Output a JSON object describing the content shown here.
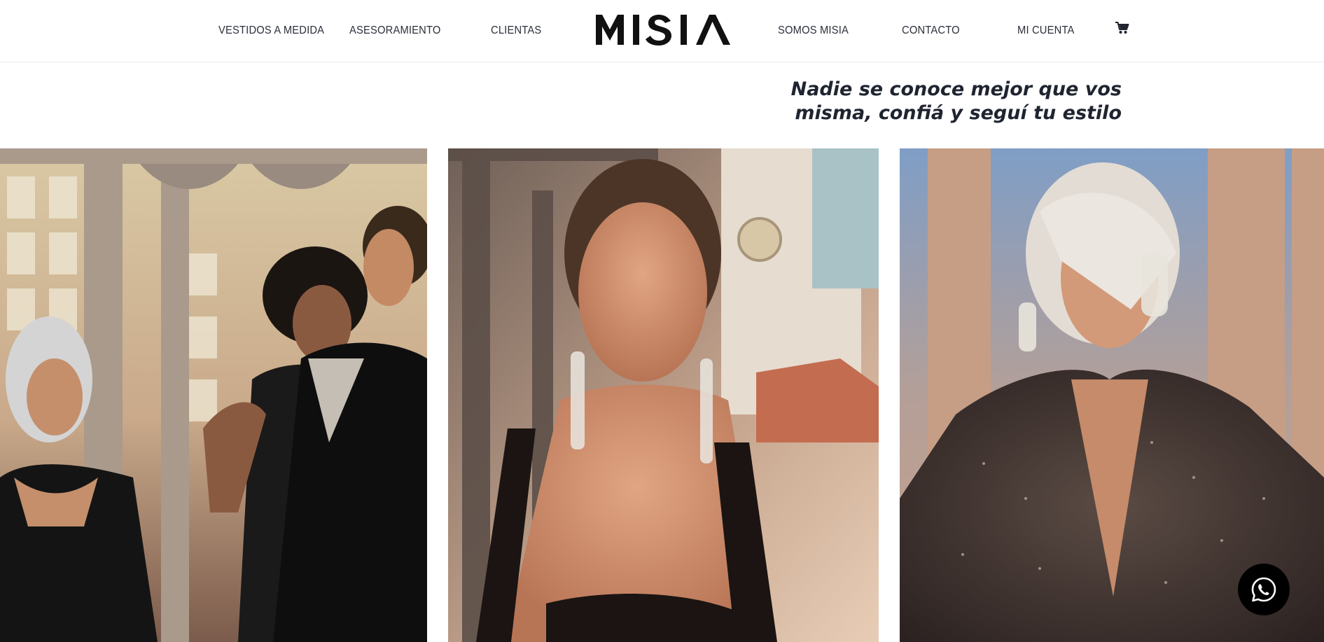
{
  "nav": {
    "left": [
      "VESTIDOS A MEDIDA",
      "ASESORAMIENTO",
      "CLIENTAS"
    ],
    "right": [
      "SOMOS MISIA",
      "CONTACTO",
      "MI CUENTA"
    ]
  },
  "brand": {
    "logo": "MISIA"
  },
  "hero": {
    "tagline_line1": "Nadie se conoce mejor que vos",
    "tagline_line2": "misma, confiá y seguí tu estilo"
  },
  "icons": {
    "cart": "cart-icon",
    "whatsapp": "whatsapp-icon"
  },
  "colors": {
    "nav_text": "#2b2f3a",
    "logo": "#111111",
    "tagline": "#1f2430",
    "whatsapp_button": "#000000"
  }
}
